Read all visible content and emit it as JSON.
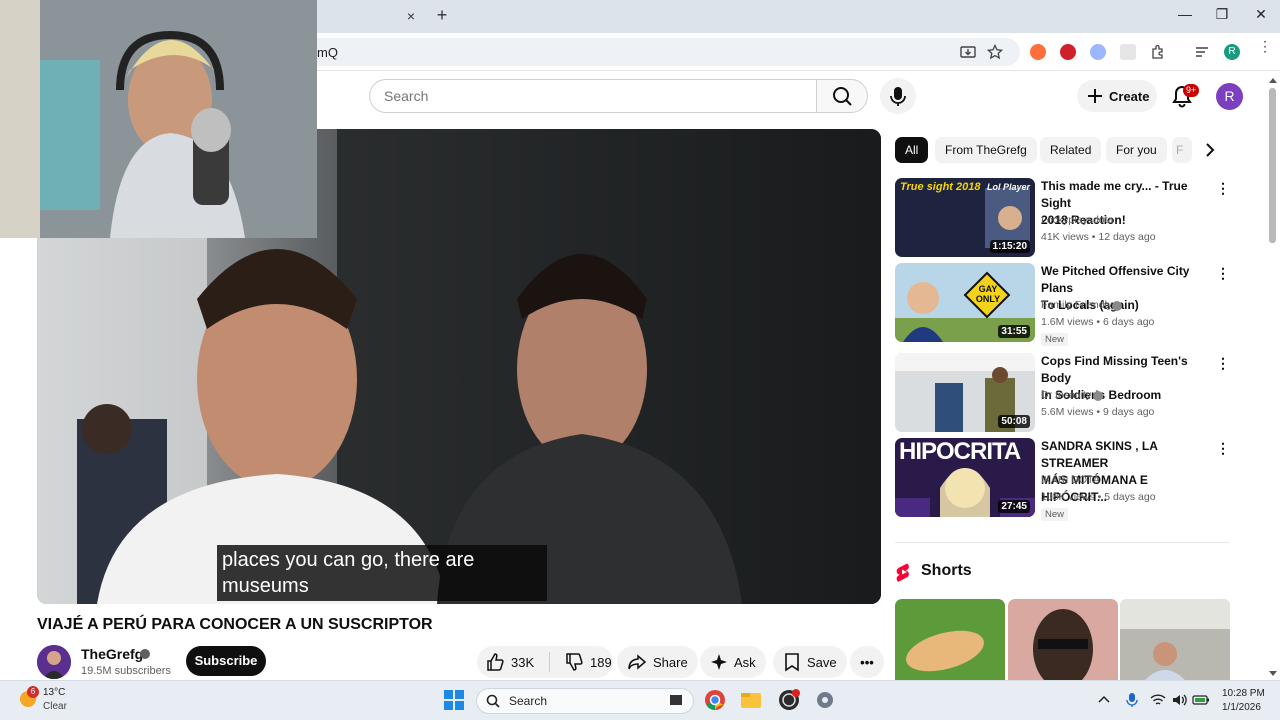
{
  "browser": {
    "tab_close": "×",
    "new_tab": "+",
    "url_fragment": "mQ",
    "window_controls": {
      "minimize": "—",
      "maximize": "❐",
      "close": "✕"
    }
  },
  "youtube_header": {
    "search_placeholder": "Search",
    "create_label": "Create",
    "notification_badge": "9+",
    "profile_initial": "R"
  },
  "video": {
    "caption_line1": "places you can go, there are",
    "caption_line2": "museums",
    "title": "VIAJÉ A PERÚ PARA CONOCER A UN SUSCRIPTOR",
    "channel_name": "TheGrefg",
    "subscribers": "19.5M subscribers",
    "subscribe_label": "Subscribe",
    "likes": "33K",
    "dislikes": "189",
    "share_label": "Share",
    "ask_label": "Ask",
    "save_label": "Save",
    "more": "•••"
  },
  "chips": [
    "All",
    "From TheGrefg",
    "Related",
    "For you",
    "F"
  ],
  "recommendations": [
    {
      "title_line1": "This made me cry... - True Sight",
      "title_line2": "2018 Reaction!",
      "channel": "Lockyplaysdota",
      "meta": "41K views • 12 days ago",
      "duration": "1:15:20",
      "new": "",
      "thumb_text_1": "True sight 2018",
      "thumb_text_2": "Lol Player"
    },
    {
      "title_line1": "We Pitched Offensive City Plans",
      "title_line2": "To Locals (again)",
      "channel": "Family Friendly",
      "meta": "1.6M views • 6 days ago",
      "duration": "31:55",
      "new": "New",
      "thumb_text_1": "GAY",
      "thumb_text_2": "ONLY"
    },
    {
      "title_line1": "Cops Find Missing Teen's Body",
      "title_line2": "In Soldier's Bedroom",
      "channel": "Dr Insanity",
      "meta": "5.6M views • 9 days ago",
      "duration": "50:08",
      "new": "",
      "thumb_text_1": "",
      "thumb_text_2": ""
    },
    {
      "title_line1": "SANDRA SKINS , LA STREAMER",
      "title_line2": "MÁS MITÓMANA E HIPÓCRIT...",
      "channel": "IKARI DOTA",
      "meta": "108K views • 5 days ago",
      "duration": "27:45",
      "new": "New",
      "thumb_text_1": "HIPOCRITA",
      "thumb_text_2": ""
    }
  ],
  "shorts": {
    "title": "Shorts"
  },
  "taskbar": {
    "weather_badge": "6",
    "temperature": "13°C",
    "condition": "Clear",
    "search_label": "Search",
    "time": "10:28 PM",
    "date": "1/1/2026"
  },
  "colors": {
    "youtube_red": "#ff0000",
    "avatar_purple": "#7b3fbf",
    "badge_red": "#cc0000"
  }
}
